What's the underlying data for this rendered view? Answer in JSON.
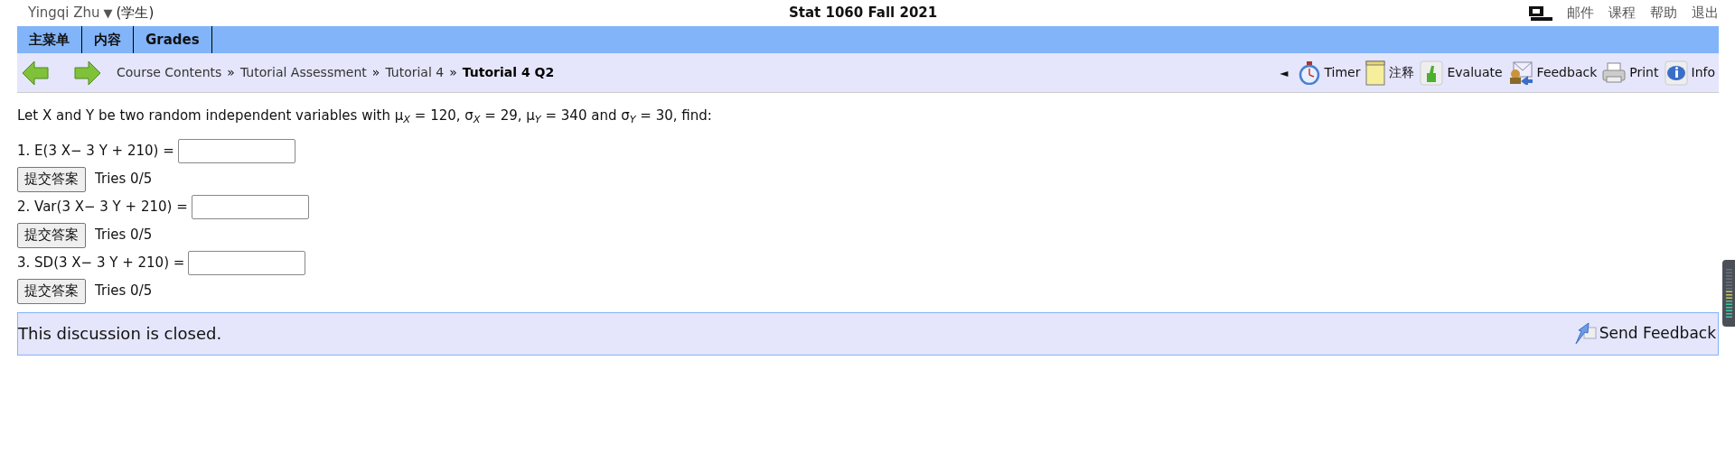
{
  "top_bar": {
    "user": "Yingqi Zhu",
    "user_caret": "▼",
    "role": "(学生)",
    "course_title": "Stat 1060 Fall 2021",
    "links": [
      "邮件",
      "课程",
      "帮助",
      "退出"
    ]
  },
  "tabs": [
    {
      "label": "主菜单",
      "selected": false
    },
    {
      "label": "内容",
      "selected": false
    },
    {
      "label": "Grades",
      "selected": false
    }
  ],
  "breadcrumbs": [
    {
      "label": "Course Contents",
      "current": false
    },
    {
      "label": "Tutorial Assessment",
      "current": false
    },
    {
      "label": "Tutorial 4",
      "current": false
    },
    {
      "label": "Tutorial 4 Q2",
      "current": true
    }
  ],
  "breadcrumb_separator": "»",
  "collapse_arrow": "◄",
  "tools": [
    {
      "kind": "timer",
      "label": "Timer"
    },
    {
      "kind": "note",
      "label": "注释"
    },
    {
      "kind": "evaluate",
      "label": "Evaluate"
    },
    {
      "kind": "feedback",
      "label": "Feedback"
    },
    {
      "kind": "print",
      "label": "Print"
    },
    {
      "kind": "info",
      "label": "Info"
    }
  ],
  "problem": "Let X and Y be two random independent variables with μ$_{X}$ = 120, σ$_{X}$ = 29, μ$_{Y}$ = 340 and σ$_{Y}$ = 30, find:",
  "questions": [
    {
      "prompt": "1. E(3 X− 3 Y + 210) =",
      "button": "提交答案",
      "tries": "Tries 0/5"
    },
    {
      "prompt": "2. Var(3 X− 3 Y + 210) =",
      "button": "提交答案",
      "tries": "Tries 0/5"
    },
    {
      "prompt": "3. SD(3 X− 3 Y + 210) =",
      "button": "提交答案",
      "tries": "Tries 0/5"
    }
  ],
  "discussion": {
    "message": "This discussion is closed.",
    "send_feedback": "Send Feedback"
  }
}
